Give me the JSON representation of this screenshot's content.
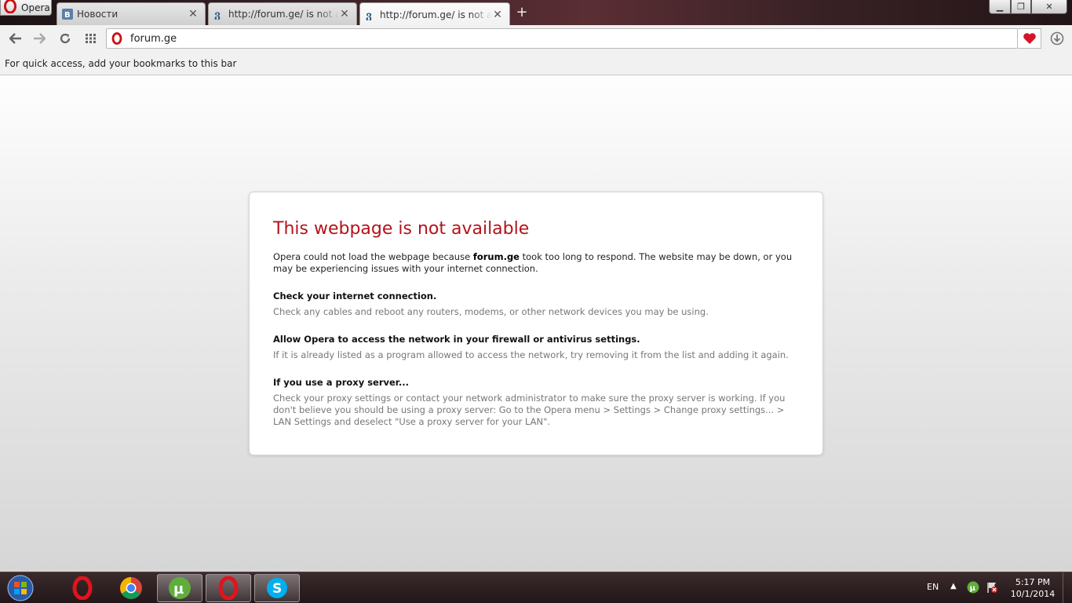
{
  "browser": {
    "menu_label": "Opera",
    "tabs": [
      {
        "title": "Новости",
        "favicon": "vk-icon"
      },
      {
        "title": "http://forum.ge/ is not available",
        "favicon": "forum-icon"
      },
      {
        "title": "http://forum.ge/ is not available",
        "favicon": "forum-icon"
      }
    ],
    "address": "forum.ge",
    "bookmarks_hint": "For quick access, add your bookmarks to this bar"
  },
  "error_page": {
    "title": "This webpage is not available",
    "lead_before": "Opera could not load the webpage because ",
    "lead_host": "forum.ge",
    "lead_after": " took too long to respond. The website may be down, or you may be experiencing issues with your internet connection.",
    "tips": [
      {
        "heading": "Check your internet connection.",
        "text": "Check any cables and reboot any routers, modems, or other network devices you may be using."
      },
      {
        "heading": "Allow Opera to access the network in your firewall or antivirus settings.",
        "text": "If it is already listed as a program allowed to access the network, try removing it from the list and adding it again."
      },
      {
        "heading": "If you use a proxy server...",
        "text": "Check your proxy settings or contact your network administrator to make sure the proxy server is working. If you don't believe you should be using a proxy server: Go to the Opera menu > Settings > Change proxy settings... > LAN Settings and deselect \"Use a proxy server for your LAN\"."
      }
    ]
  },
  "taskbar": {
    "language": "EN",
    "time": "5:17 PM",
    "date": "10/1/2014"
  },
  "colors": {
    "error_red": "#b3131a",
    "opera_red": "#cc0f16"
  }
}
